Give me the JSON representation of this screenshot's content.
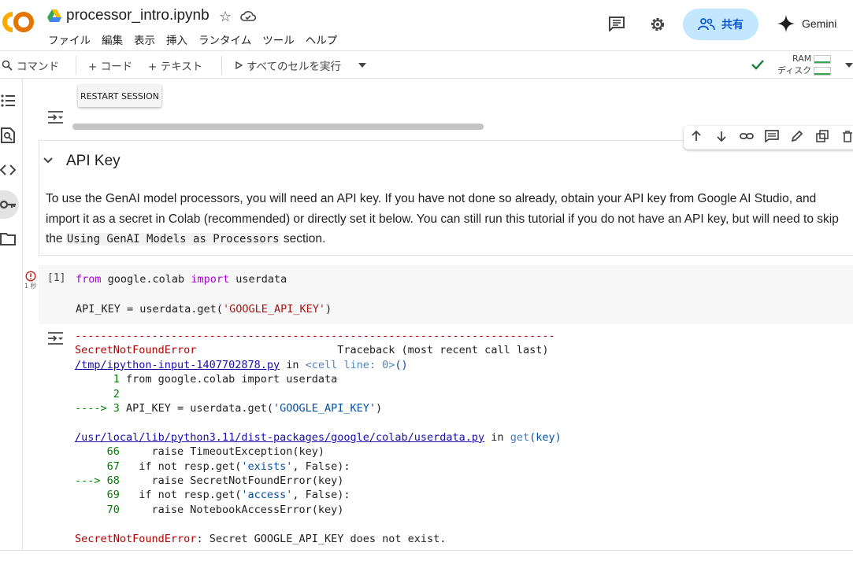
{
  "header": {
    "title": "processor_intro.ipynb",
    "share_label": "共有",
    "gemini_label": "Gemini",
    "brand_color": "#f9ab00"
  },
  "menu": [
    "ファイル",
    "編集",
    "表示",
    "挿入",
    "ランタイム",
    "ツール",
    "ヘルプ"
  ],
  "toolbar": {
    "command_label": "コマンド",
    "add_code_label": "+ コード",
    "add_text_label": "+ テキスト",
    "run_all_label": "すべてのセルを実行",
    "ram_label": "RAM",
    "disk_label": "ディスク"
  },
  "tooltip": "RESTART SESSION",
  "markdown_cell": {
    "heading": "API Key",
    "body_before": "To use the GenAI model processors, you will need an API key. If you have not done so already, obtain your API key from Google AI Studio, and import it as a secret in Colab (recommended) or directly set it below. You can still run this tutorial if you do not have an API key, but will need to skip the ",
    "body_code": "Using GenAI Models as Processors",
    "body_after": " section."
  },
  "code_cell": {
    "exec_count": "[1]",
    "duration": "1 秒",
    "line1": {
      "kw1": "from",
      "mod": " google.colab ",
      "kw2": "import",
      "name": " userdata"
    },
    "line2": {
      "pre": "API_KEY = userdata.get(",
      "str": "'GOOGLE_API_KEY'",
      "post": ")"
    }
  },
  "output": {
    "dashes": "---------------------------------------------------------------------------",
    "error_name": "SecretNotFoundError",
    "traceback_header": "Traceback (most recent call last)",
    "frame1_file": "/tmp/ipython-input-1407702878.py",
    "frame1_in": " in ",
    "frame1_loc": "<cell line: 0>",
    "frame1_paren": "()",
    "f1_l1_num": "      1 ",
    "f1_l1_code": "from google.colab import userdata",
    "f1_l2_num": "      2",
    "f1_l3_arrow": "----> 3 ",
    "f1_l3_pre": "API_KEY = userdata.get(",
    "f1_l3_str": "'GOOGLE_API_KEY'",
    "f1_l3_post": ")",
    "frame2_file": "/usr/local/lib/python3.11/dist-packages/google/colab/userdata.py",
    "frame2_in": " in ",
    "frame2_func": "get",
    "frame2_args": "(key)",
    "f2_l66_num": "     66 ",
    "f2_l66_code": "    raise TimeoutException(key)",
    "f2_l67_num": "     67 ",
    "f2_l67_pre": "  if not resp.get(",
    "f2_l67_str": "'exists'",
    "f2_l67_post": ", False):",
    "f2_l68_arrow": "---> 68 ",
    "f2_l68_code": "    raise SecretNotFoundError(key)",
    "f2_l69_num": "     69 ",
    "f2_l69_pre": "  if not resp.get(",
    "f2_l69_str": "'access'",
    "f2_l69_post": ", False):",
    "f2_l70_num": "     70 ",
    "f2_l70_code": "    raise NotebookAccessError(key)",
    "final_name": "SecretNotFoundError",
    "final_msg": ": Secret GOOGLE_API_KEY does not exist."
  }
}
